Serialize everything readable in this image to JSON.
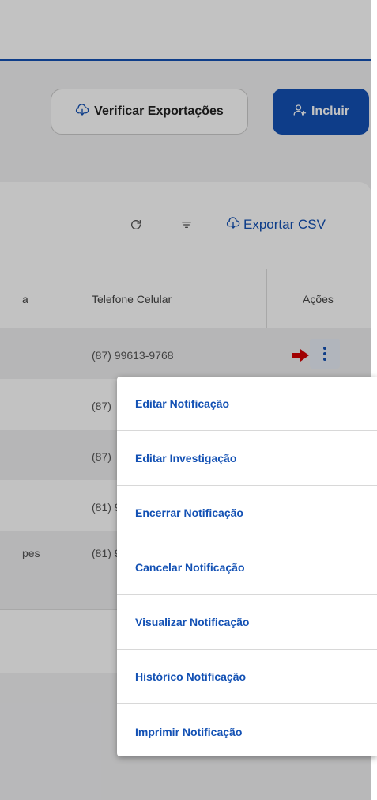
{
  "header": {
    "verify_exports_label": "Verificar Exportações",
    "include_label": "Incluir"
  },
  "toolbar": {
    "export_csv_label": "Exportar CSV"
  },
  "table": {
    "columns": {
      "left_partial": "a",
      "phone": "Telefone Celular",
      "actions": "Ações"
    },
    "rows": [
      {
        "left": "",
        "phone": "(87) 99613-9768"
      },
      {
        "left": "",
        "phone": "(87)"
      },
      {
        "left": "",
        "phone": "(87)"
      },
      {
        "left": "",
        "phone": "(81) 9"
      },
      {
        "left": "pes",
        "phone": "(81) 9"
      }
    ]
  },
  "menu": {
    "items": [
      "Editar Notificação",
      "Editar Investigação",
      "Encerrar Notificação",
      "Cancelar Notificação",
      "Visualizar Notificação",
      "Histórico Notificação",
      "Imprimir Notificação"
    ]
  },
  "colors": {
    "primary": "#1351b4",
    "arrow": "#d40000"
  },
  "icons": {
    "verify_exports": "cloud-download-icon",
    "include": "add-user-icon",
    "refresh": "refresh-icon",
    "filter": "filter-icon",
    "export_csv": "cloud-download-icon",
    "row_actions": "kebab-menu-icon",
    "pointer": "red-arrow-icon"
  }
}
